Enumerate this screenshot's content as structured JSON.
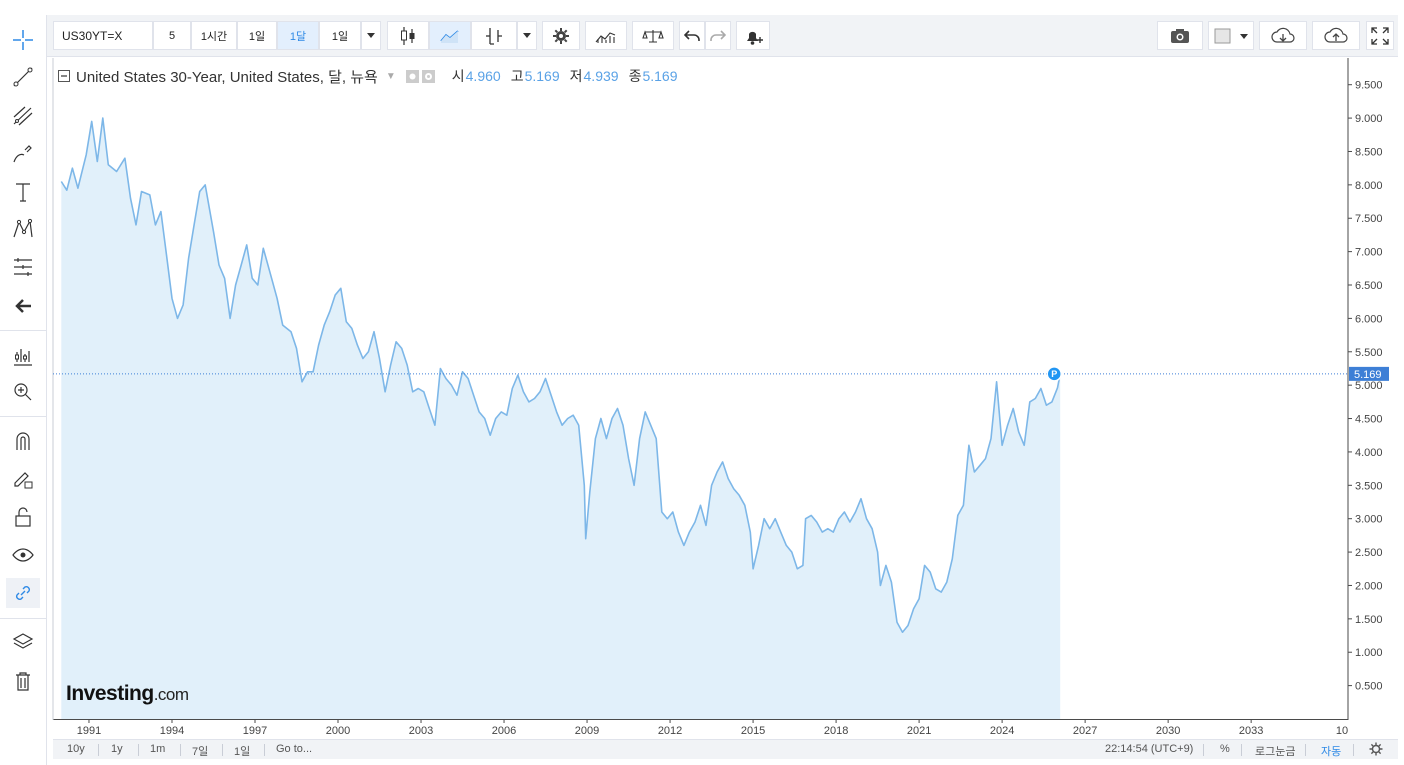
{
  "toolbar": {
    "symbol": "US30YT=X",
    "items": [
      "5",
      "1시간",
      "1일",
      "1달",
      "1일"
    ]
  },
  "legend": {
    "title": "United States 30-Year, United States, 달, 뉴욕",
    "open_label": "시",
    "open_value": "4.960",
    "high_label": "고",
    "high_value": "5.169",
    "low_label": "저",
    "low_value": "4.939",
    "close_label": "종",
    "close_value": "5.169"
  },
  "price_axis": {
    "ticks": [
      "9.500",
      "9.000",
      "8.500",
      "8.000",
      "7.500",
      "7.000",
      "6.500",
      "6.000",
      "5.500",
      "5.000",
      "4.500",
      "4.000",
      "3.500",
      "3.000",
      "2.500",
      "2.000",
      "1.500",
      "1.000",
      "0.500"
    ],
    "current_label": "5.169"
  },
  "time_axis": {
    "ticks": [
      "1991",
      "1994",
      "1997",
      "2000",
      "2003",
      "2006",
      "2009",
      "2012",
      "2015",
      "2018",
      "2021",
      "2024",
      "2027",
      "2030",
      "2033",
      "10"
    ]
  },
  "bottom_bar": {
    "ranges": [
      "10y",
      "1y",
      "1m",
      "7일",
      "1일",
      "Go to..."
    ],
    "clock": "22:14:54 (UTC+9)",
    "percent": "%",
    "log": "로그눈금",
    "auto": "자동"
  },
  "logo": {
    "main": "Investing",
    "suffix": ".com"
  },
  "colors": {
    "line": "#7db7e8",
    "area": "#e1f0fa",
    "current_badge": "#3d7fd6",
    "marker": "#2196f3",
    "toolbar_bg": "#f1f3f6",
    "active_blue": "#2f8ae6"
  },
  "icons": {
    "left_toolbar": [
      "crosshair-icon",
      "trend-line-icon",
      "fib-icon",
      "brush-icon",
      "text-icon",
      "pattern-icon",
      "measure-icon",
      "arrow-left-icon",
      "forecast-icon",
      "zoom-icon",
      "magnet-icon",
      "lock-draw-icon",
      "lock-icon",
      "eye-icon",
      "link-icon",
      "layers-icon",
      "trash-icon"
    ],
    "top_toolbar": [
      "candles-icon",
      "area-icon",
      "indicator-icon",
      "settings-icon",
      "compare-icon",
      "balance-icon",
      "undo-icon",
      "redo-icon",
      "alert-icon",
      "camera-icon",
      "color-icon",
      "cloud-download-icon",
      "cloud-upload-icon",
      "fullscreen-icon"
    ]
  },
  "chart_data": {
    "type": "area",
    "title": "United States 30-Year, United States, 달, 뉴욕",
    "xlabel": "",
    "ylabel": "",
    "xlim": [
      1989.7,
      2036.5
    ],
    "ylim": [
      0,
      9.9
    ],
    "grid": false,
    "legend": "top-left",
    "current_value": 5.169,
    "series": [
      {
        "points": [
          [
            1990.0,
            8.05
          ],
          [
            1990.2,
            7.92
          ],
          [
            1990.4,
            8.25
          ],
          [
            1990.6,
            7.95
          ],
          [
            1990.9,
            8.45
          ],
          [
            1991.1,
            8.95
          ],
          [
            1991.3,
            8.35
          ],
          [
            1991.5,
            9.0
          ],
          [
            1991.7,
            8.3
          ],
          [
            1992.0,
            8.2
          ],
          [
            1992.3,
            8.4
          ],
          [
            1992.5,
            7.8
          ],
          [
            1992.7,
            7.4
          ],
          [
            1992.9,
            7.9
          ],
          [
            1993.2,
            7.85
          ],
          [
            1993.4,
            7.4
          ],
          [
            1993.6,
            7.6
          ],
          [
            1993.8,
            6.95
          ],
          [
            1994.0,
            6.3
          ],
          [
            1994.2,
            6.0
          ],
          [
            1994.4,
            6.2
          ],
          [
            1994.6,
            6.9
          ],
          [
            1994.8,
            7.4
          ],
          [
            1995.0,
            7.9
          ],
          [
            1995.2,
            8.0
          ],
          [
            1995.5,
            7.3
          ],
          [
            1995.7,
            6.8
          ],
          [
            1995.9,
            6.6
          ],
          [
            1996.1,
            6.0
          ],
          [
            1996.3,
            6.5
          ],
          [
            1996.5,
            6.8
          ],
          [
            1996.7,
            7.1
          ],
          [
            1996.9,
            6.6
          ],
          [
            1997.1,
            6.5
          ],
          [
            1997.3,
            7.05
          ],
          [
            1997.6,
            6.6
          ],
          [
            1997.8,
            6.3
          ],
          [
            1998.0,
            5.9
          ],
          [
            1998.3,
            5.8
          ],
          [
            1998.5,
            5.55
          ],
          [
            1998.7,
            5.05
          ],
          [
            1998.9,
            5.2
          ],
          [
            1999.1,
            5.2
          ],
          [
            1999.3,
            5.6
          ],
          [
            1999.5,
            5.9
          ],
          [
            1999.7,
            6.1
          ],
          [
            1999.9,
            6.35
          ],
          [
            2000.1,
            6.45
          ],
          [
            2000.3,
            5.95
          ],
          [
            2000.5,
            5.85
          ],
          [
            2000.7,
            5.6
          ],
          [
            2000.9,
            5.4
          ],
          [
            2001.1,
            5.5
          ],
          [
            2001.3,
            5.8
          ],
          [
            2001.5,
            5.4
          ],
          [
            2001.7,
            4.9
          ],
          [
            2001.9,
            5.3
          ],
          [
            2002.1,
            5.65
          ],
          [
            2002.3,
            5.55
          ],
          [
            2002.5,
            5.3
          ],
          [
            2002.7,
            4.9
          ],
          [
            2002.9,
            4.95
          ],
          [
            2003.1,
            4.9
          ],
          [
            2003.3,
            4.65
          ],
          [
            2003.5,
            4.4
          ],
          [
            2003.7,
            5.25
          ],
          [
            2003.9,
            5.1
          ],
          [
            2004.1,
            5.0
          ],
          [
            2004.3,
            4.85
          ],
          [
            2004.5,
            5.2
          ],
          [
            2004.7,
            5.1
          ],
          [
            2004.9,
            4.85
          ],
          [
            2005.1,
            4.6
          ],
          [
            2005.3,
            4.5
          ],
          [
            2005.5,
            4.25
          ],
          [
            2005.7,
            4.5
          ],
          [
            2005.9,
            4.6
          ],
          [
            2006.1,
            4.55
          ],
          [
            2006.3,
            4.95
          ],
          [
            2006.5,
            5.15
          ],
          [
            2006.7,
            4.9
          ],
          [
            2006.9,
            4.75
          ],
          [
            2007.1,
            4.8
          ],
          [
            2007.3,
            4.9
          ],
          [
            2007.5,
            5.1
          ],
          [
            2007.7,
            4.85
          ],
          [
            2007.9,
            4.6
          ],
          [
            2008.1,
            4.4
          ],
          [
            2008.3,
            4.5
          ],
          [
            2008.5,
            4.55
          ],
          [
            2008.7,
            4.4
          ],
          [
            2008.9,
            3.5
          ],
          [
            2008.95,
            2.7
          ],
          [
            2009.1,
            3.4
          ],
          [
            2009.3,
            4.2
          ],
          [
            2009.5,
            4.5
          ],
          [
            2009.7,
            4.2
          ],
          [
            2009.9,
            4.5
          ],
          [
            2010.1,
            4.65
          ],
          [
            2010.3,
            4.4
          ],
          [
            2010.5,
            3.9
          ],
          [
            2010.7,
            3.5
          ],
          [
            2010.9,
            4.2
          ],
          [
            2011.1,
            4.6
          ],
          [
            2011.3,
            4.4
          ],
          [
            2011.5,
            4.2
          ],
          [
            2011.7,
            3.1
          ],
          [
            2011.9,
            3.0
          ],
          [
            2012.1,
            3.1
          ],
          [
            2012.3,
            2.8
          ],
          [
            2012.5,
            2.6
          ],
          [
            2012.7,
            2.8
          ],
          [
            2012.9,
            2.95
          ],
          [
            2013.1,
            3.2
          ],
          [
            2013.3,
            2.9
          ],
          [
            2013.5,
            3.5
          ],
          [
            2013.7,
            3.7
          ],
          [
            2013.9,
            3.85
          ],
          [
            2014.1,
            3.6
          ],
          [
            2014.3,
            3.45
          ],
          [
            2014.5,
            3.35
          ],
          [
            2014.7,
            3.2
          ],
          [
            2014.9,
            2.8
          ],
          [
            2015.0,
            2.25
          ],
          [
            2015.2,
            2.6
          ],
          [
            2015.4,
            3.0
          ],
          [
            2015.6,
            2.85
          ],
          [
            2015.8,
            3.0
          ],
          [
            2016.0,
            2.8
          ],
          [
            2016.2,
            2.6
          ],
          [
            2016.4,
            2.5
          ],
          [
            2016.6,
            2.25
          ],
          [
            2016.8,
            2.3
          ],
          [
            2016.9,
            3.0
          ],
          [
            2017.1,
            3.05
          ],
          [
            2017.3,
            2.95
          ],
          [
            2017.5,
            2.8
          ],
          [
            2017.7,
            2.85
          ],
          [
            2017.9,
            2.8
          ],
          [
            2018.1,
            3.0
          ],
          [
            2018.3,
            3.1
          ],
          [
            2018.5,
            2.95
          ],
          [
            2018.7,
            3.1
          ],
          [
            2018.9,
            3.3
          ],
          [
            2019.1,
            3.0
          ],
          [
            2019.3,
            2.85
          ],
          [
            2019.5,
            2.5
          ],
          [
            2019.6,
            2.0
          ],
          [
            2019.8,
            2.3
          ],
          [
            2020.0,
            2.05
          ],
          [
            2020.2,
            1.45
          ],
          [
            2020.4,
            1.3
          ],
          [
            2020.6,
            1.4
          ],
          [
            2020.8,
            1.65
          ],
          [
            2021.0,
            1.8
          ],
          [
            2021.2,
            2.3
          ],
          [
            2021.4,
            2.2
          ],
          [
            2021.6,
            1.95
          ],
          [
            2021.8,
            1.9
          ],
          [
            2022.0,
            2.05
          ],
          [
            2022.2,
            2.4
          ],
          [
            2022.4,
            3.05
          ],
          [
            2022.6,
            3.2
          ],
          [
            2022.8,
            4.1
          ],
          [
            2023.0,
            3.7
          ],
          [
            2023.2,
            3.8
          ],
          [
            2023.4,
            3.9
          ],
          [
            2023.6,
            4.2
          ],
          [
            2023.8,
            5.05
          ],
          [
            2024.0,
            4.1
          ],
          [
            2024.2,
            4.4
          ],
          [
            2024.4,
            4.65
          ],
          [
            2024.6,
            4.3
          ],
          [
            2024.8,
            4.1
          ],
          [
            2025.0,
            4.75
          ],
          [
            2025.2,
            4.8
          ],
          [
            2025.4,
            4.95
          ],
          [
            2025.6,
            4.7
          ],
          [
            2025.8,
            4.75
          ],
          [
            2026.0,
            4.96
          ],
          [
            2026.1,
            5.169
          ]
        ]
      }
    ]
  }
}
